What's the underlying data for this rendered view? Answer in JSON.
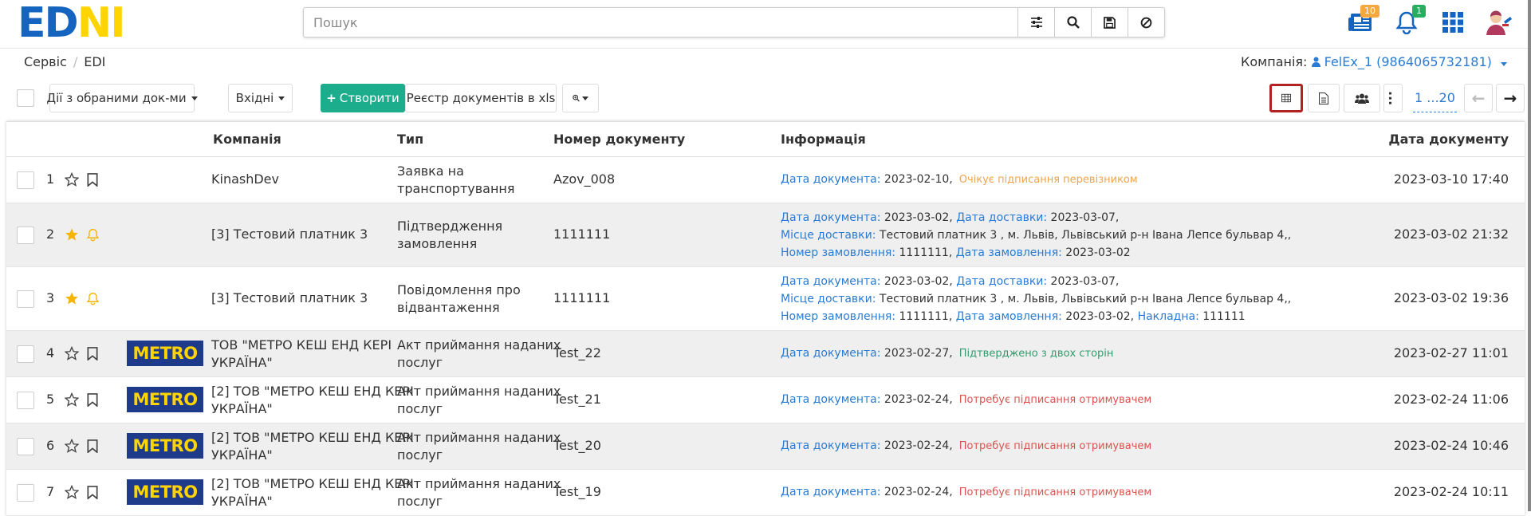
{
  "logo": {
    "part1": "ED",
    "part2": "N",
    "part3": "I"
  },
  "search": {
    "placeholder": "Пошук"
  },
  "badges": {
    "news": "10",
    "notifications": "1"
  },
  "colors": {
    "accent": "#2a7bd4",
    "create": "#1cae8c",
    "badge_orange": "#f4a940",
    "badge_green": "#27ae60",
    "metro_bg": "#1e3a8a",
    "metro_fg": "#ffd400"
  },
  "breadcrumb": {
    "item1": "Сервіс",
    "item2": "EDI"
  },
  "company": {
    "label": "Компанія:",
    "value": "FelEx_1 (9864065732181)"
  },
  "toolbar": {
    "actions": "Дії з обраними док-ми",
    "inbox": "Вхідні",
    "create": "Створити",
    "registry": "Реєстр документів в xls",
    "pager": "1 ...20"
  },
  "columns": {
    "company": "Компанія",
    "type": "Тип",
    "number": "Номер документу",
    "info": "Інформація",
    "date": "Дата документу"
  },
  "rows": [
    {
      "n": "1",
      "company": "KinashDev",
      "type1": "Заявка на",
      "type2": "транспортування",
      "number": "Azov_008",
      "l1a": "Дата документа:",
      "v1a": " 2023-02-10,",
      "status": "Очікує підписання перевізником",
      "date": "2023-03-10 17:40"
    },
    {
      "n": "2",
      "company": "[3] Тестовий платник 3",
      "type1": "Підтвердження",
      "type2": "замовлення",
      "number": "1111111",
      "l1a": "Дата документа:",
      "v1a": " 2023-03-02,",
      "l1b": "Дата доставки:",
      "v1b": " 2023-03-07,",
      "l2a": "Місце доставки:",
      "v2a": " Тестовий платник 3 , м. Львів, Львівський р-н Івана Лепсе бульвар 4,,",
      "l3a": "Номер замовлення:",
      "v3a": " 1111111,",
      "l3b": "Дата замовлення:",
      "v3b": " 2023-03-02",
      "date": "2023-03-02 21:32"
    },
    {
      "n": "3",
      "company": "[3] Тестовий платник 3",
      "type1": "Повідомлення про",
      "type2": "відвантаження",
      "number": "1111111",
      "l1a": "Дата документа:",
      "v1a": " 2023-03-02,",
      "l1b": "Дата доставки:",
      "v1b": " 2023-03-07,",
      "l2a": "Місце доставки:",
      "v2a": " Тестовий платник 3 , м. Львів, Львівський р-н Івана Лепсе бульвар 4,,",
      "l3a": "Номер замовлення:",
      "v3a": " 1111111,",
      "l3b": "Дата замовлення:",
      "v3b": " 2023-03-02,",
      "l3c": "Накладна:",
      "v3c": " 111111",
      "date": "2023-03-02 19:36"
    },
    {
      "n": "4",
      "logo": "METRO",
      "company1": "ТОВ \"МЕТРО КЕШ ЕНД КЕРІ",
      "company2": "УКРАЇНА\"",
      "type1": "Акт приймання наданих",
      "type2": "послуг",
      "number": "Test_22",
      "l1a": "Дата документа:",
      "v1a": " 2023-02-27,",
      "status": "Підтверджено з двох сторін",
      "date": "2023-02-27 11:01"
    },
    {
      "n": "5",
      "logo": "METRO",
      "company1": "[2] ТОВ \"МЕТРО КЕШ ЕНД КЕРІ",
      "company2": "УКРАЇНА\"",
      "type1": "Акт приймання наданих",
      "type2": "послуг",
      "number": "Test_21",
      "l1a": "Дата документа:",
      "v1a": " 2023-02-24,",
      "status": "Потребує підписання отримувачем",
      "date": "2023-02-24 11:06"
    },
    {
      "n": "6",
      "logo": "METRO",
      "company1": "[2] ТОВ \"МЕТРО КЕШ ЕНД КЕРІ",
      "company2": "УКРАЇНА\"",
      "type1": "Акт приймання наданих",
      "type2": "послуг",
      "number": "Test_20",
      "l1a": "Дата документа:",
      "v1a": " 2023-02-24,",
      "status": "Потребує підписання отримувачем",
      "date": "2023-02-24 10:46"
    },
    {
      "n": "7",
      "logo": "METRO",
      "company1": "[2] ТОВ \"МЕТРО КЕШ ЕНД КЕРІ",
      "company2": "УКРАЇНА\"",
      "type1": "Акт приймання наданих",
      "type2": "послуг",
      "number": "Test_19",
      "l1a": "Дата документа:",
      "v1a": " 2023-02-24,",
      "status": "Потребує підписання отримувачем",
      "date": "2023-02-24 10:11"
    }
  ]
}
